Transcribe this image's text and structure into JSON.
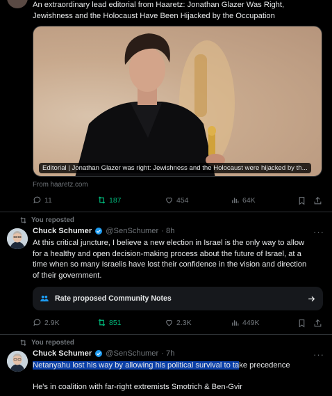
{
  "post1": {
    "text_line1": "An extraordinary lead editorial from Haaretz: Jonathan Glazer Was Right,",
    "text_line2": "Jewishness and the Holocaust Have Been Hijacked by the Occupation",
    "card_caption": "Editorial | Jonathan Glazer was right: Jewishness and the Holocaust were hijacked by th...",
    "source": "From haaretz.com",
    "replies": "11",
    "reposts": "187",
    "likes": "454",
    "views": "64K"
  },
  "post2": {
    "reposted_label": "You reposted",
    "name": "Chuck Schumer",
    "handle": "@SenSchumer",
    "time": "· 8h",
    "lines": [
      "At this critical juncture, I believe a new election in Israel is the only way to allow",
      "for a healthy and open decision-making process about the future of Israel, at a",
      "time when so many Israelis have lost their confidence in the vision and direction",
      "of their government."
    ],
    "notes_button": "Rate proposed Community Notes",
    "replies": "2.9K",
    "reposts": "851",
    "likes": "2.3K",
    "views": "449K"
  },
  "post3": {
    "reposted_label": "You reposted",
    "name": "Chuck Schumer",
    "handle": "@SenSchumer",
    "time": "· 7h",
    "line1_selected": "Netanyahu lost his way by allowing his political survival to ta",
    "line1_rest": "ke precedence",
    "line2": "He's in coalition with far-right extremists Smotrich & Ben-Gvir"
  },
  "colors": {
    "background": "#000000",
    "text": "#e7e9ea",
    "muted": "#71767b",
    "repost_green": "#00ba7c",
    "verified_blue": "#1d9bf0",
    "selection": "#0a3fa8"
  }
}
